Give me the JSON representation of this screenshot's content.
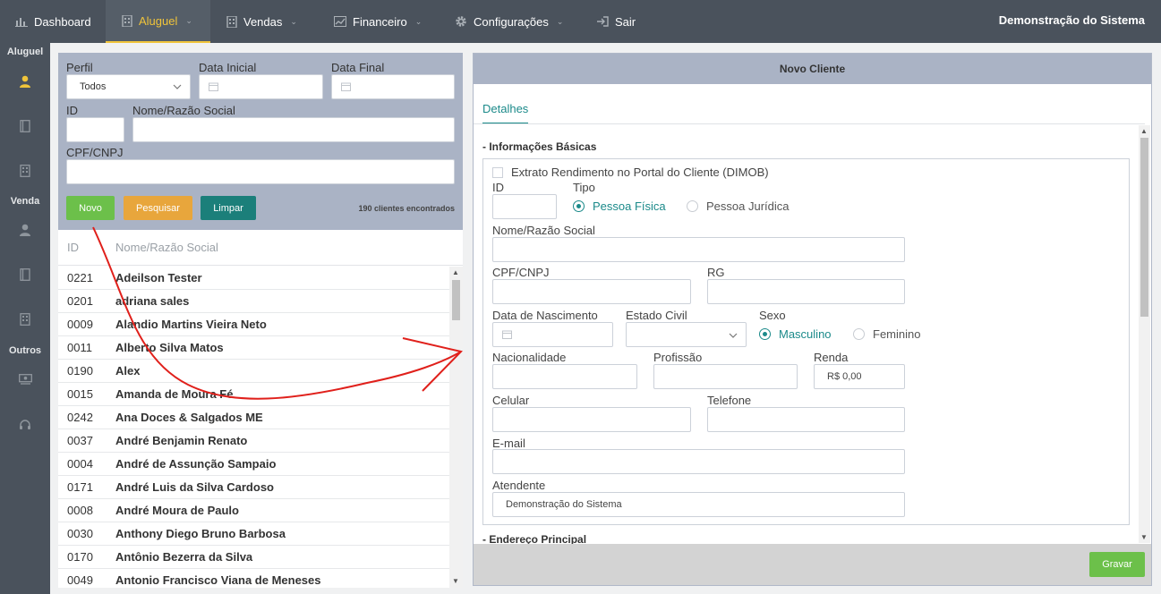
{
  "nav": {
    "dashboard": "Dashboard",
    "aluguel": "Aluguel",
    "vendas": "Vendas",
    "financeiro": "Financeiro",
    "configuracoes": "Configurações",
    "sair": "Sair",
    "brand": "Demonstração do Sistema"
  },
  "sidebar": {
    "aluguel": "Aluguel",
    "venda": "Venda",
    "outros": "Outros"
  },
  "filter": {
    "perfil_label": "Perfil",
    "perfil_value": "Todos",
    "data_inicial_label": "Data Inicial",
    "data_final_label": "Data Final",
    "id_label": "ID",
    "nome_label": "Nome/Razão Social",
    "cpf_label": "CPF/CNPJ",
    "btn_novo": "Novo",
    "btn_pesquisar": "Pesquisar",
    "btn_limpar": "Limpar",
    "count": "190 clientes encontrados"
  },
  "list": {
    "col_id": "ID",
    "col_nome": "Nome/Razão Social",
    "rows": [
      {
        "id": "0221",
        "name": "Adeilson Tester"
      },
      {
        "id": "0201",
        "name": "adriana sales"
      },
      {
        "id": "0009",
        "name": "Alandio Martins Vieira Neto"
      },
      {
        "id": "0011",
        "name": "Alberto Silva Matos"
      },
      {
        "id": "0190",
        "name": "Alex"
      },
      {
        "id": "0015",
        "name": "Amanda de Moura Fé"
      },
      {
        "id": "0242",
        "name": "Ana Doces & Salgados ME"
      },
      {
        "id": "0037",
        "name": "André Benjamin Renato"
      },
      {
        "id": "0004",
        "name": "André de Assunção Sampaio"
      },
      {
        "id": "0171",
        "name": "André Luis da Silva Cardoso"
      },
      {
        "id": "0008",
        "name": "André Moura de Paulo"
      },
      {
        "id": "0030",
        "name": "Anthony Diego Bruno Barbosa"
      },
      {
        "id": "0170",
        "name": "Antônio Bezerra da Silva"
      },
      {
        "id": "0049",
        "name": "Antonio Francisco Viana de Meneses"
      }
    ]
  },
  "panel": {
    "title": "Novo Cliente",
    "tab": "Detalhes",
    "section_basic": "- Informações Básicas",
    "section_address": "- Endereço Principal",
    "dimob": "Extrato Rendimento no Portal do Cliente (DIMOB)",
    "id_label": "ID",
    "tipo_label": "Tipo",
    "tipo_pf": "Pessoa Física",
    "tipo_pj": "Pessoa Jurídica",
    "nome_label": "Nome/Razão Social",
    "cpf_label": "CPF/CNPJ",
    "rg_label": "RG",
    "nasc_label": "Data de Nascimento",
    "civil_label": "Estado Civil",
    "sexo_label": "Sexo",
    "sexo_m": "Masculino",
    "sexo_f": "Feminino",
    "nac_label": "Nacionalidade",
    "prof_label": "Profissão",
    "renda_label": "Renda",
    "renda_value": "R$ 0,00",
    "cel_label": "Celular",
    "tel_label": "Telefone",
    "email_label": "E-mail",
    "atend_label": "Atendente",
    "atend_value": "Demonstração do Sistema",
    "btn_gravar": "Gravar"
  },
  "colors": {
    "topbar": "#4a525c",
    "accent_yellow": "#f0c43a",
    "teal": "#1b8a8a",
    "green": "#6cc04a",
    "orange": "#e8a63c",
    "panel_header": "#aab3c5",
    "annotation_red": "#e0201b"
  }
}
